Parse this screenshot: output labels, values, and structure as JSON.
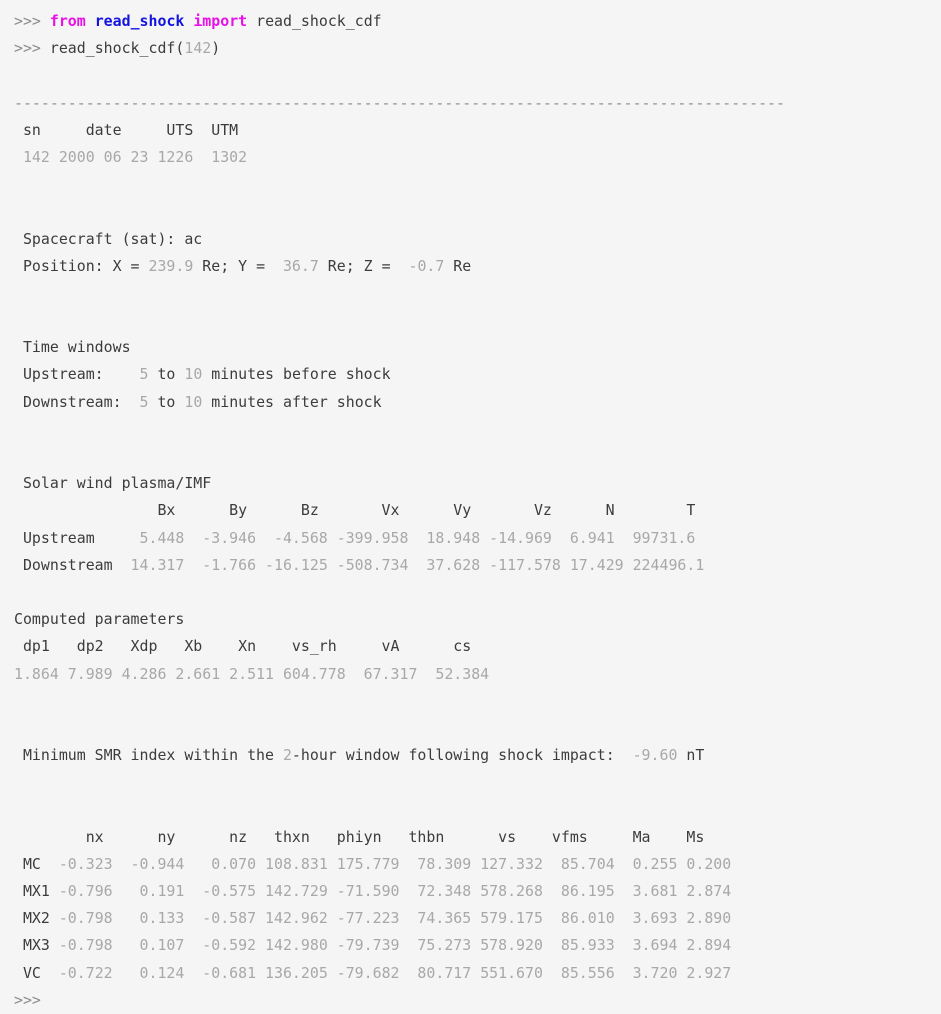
{
  "colors": {
    "background": "#f5f5f5",
    "text": "#3c3c3c",
    "value": "#a8a8a8",
    "prompt": "#8c8c8c",
    "keyword": "#e812e8",
    "module": "#1414e0",
    "separator": "#909090"
  },
  "repl": {
    "prompt": ">>>",
    "import_statement": {
      "from_keyword": "from",
      "module": "read_shock",
      "import_keyword": "import",
      "imported_name": "read_shock_cdf"
    },
    "call_statement": {
      "function": "read_shock_cdf",
      "open_paren": "(",
      "argument": "142",
      "close_paren": ")"
    },
    "trailing_prompt": ">>>"
  },
  "separator_line": "--------------------------------------------------------------------------------------",
  "event_header": {
    "columns": [
      "sn",
      "date",
      "UTS",
      "UTM"
    ],
    "header_row": " sn     date     UTS  UTM",
    "values_row": " 142 2000 06 23 1226  1302",
    "sn": "142",
    "date": "2000 06 23",
    "uts": "1226",
    "utm": "1302"
  },
  "spacecraft": {
    "label": " Spacecraft (sat): ",
    "value": "ac",
    "full_line": " Spacecraft (sat): ac"
  },
  "position": {
    "prefix": " Position: X = ",
    "x": "239.9",
    "x_unit": " Re; Y = ",
    "y": " 36.7",
    "y_unit": " Re; Z = ",
    "z": " -0.7",
    "z_unit": " Re"
  },
  "time_windows": {
    "title": " Time windows",
    "upstream": {
      "label": " Upstream:    ",
      "start": "5",
      "to": " to ",
      "end": "10",
      "suffix": " minutes before shock"
    },
    "downstream": {
      "label": " Downstream:  ",
      "start": "5",
      "to": " to ",
      "end": "10",
      "suffix": " minutes after shock"
    }
  },
  "solar_wind": {
    "title": " Solar wind plasma/IMF",
    "header_row": "                Bx      By      Bz       Vx      Vy       Vz      N        T",
    "columns": [
      "Bx",
      "By",
      "Bz",
      "Vx",
      "Vy",
      "Vz",
      "N",
      "T"
    ],
    "rows": [
      {
        "label": " Upstream",
        "row_text": " Upstream     5.448  -3.946  -4.568 -399.958  18.948 -14.969  6.941  99731.6",
        "values": [
          "5.448",
          "-3.946",
          "-4.568",
          "-399.958",
          "18.948",
          "-14.969",
          "6.941",
          "99731.6"
        ]
      },
      {
        "label": " Downstream",
        "row_text": " Downstream  14.317  -1.766 -16.125 -508.734  37.628 -117.578 17.429 224496.1",
        "values": [
          "14.317",
          "-1.766",
          "-16.125",
          "-508.734",
          "37.628",
          "-117.578",
          "17.429",
          "224496.1"
        ]
      }
    ]
  },
  "computed_parameters": {
    "title": "Computed parameters",
    "header_row": " dp1   dp2   Xdp   Xb    Xn    vs_rh     vA      cs",
    "columns": [
      "dp1",
      "dp2",
      "Xdp",
      "Xb",
      "Xn",
      "vs_rh",
      "vA",
      "cs"
    ],
    "values_row": "1.864 7.989 4.286 2.661 2.511 604.778  67.317  52.384",
    "values": [
      "1.864",
      "7.989",
      "4.286",
      "2.661",
      "2.511",
      "604.778",
      "67.317",
      "52.384"
    ]
  },
  "smr": {
    "prefix": " Minimum SMR index within the ",
    "window": "2",
    "middle": "-hour window following shock impact:  ",
    "value": "-9.60",
    "unit": " nT"
  },
  "shock_normals": {
    "header_row": "        nx      ny      nz   thxn   phiyn   thbn      vs    vfms     Ma    Ms",
    "columns": [
      "nx",
      "ny",
      "nz",
      "thxn",
      "phiyn",
      "thbn",
      "vs",
      "vfms",
      "Ma",
      "Ms"
    ],
    "rows": [
      {
        "method": "MC",
        "row_text": " MC  -0.323  -0.944   0.070 108.831 175.779  78.309 127.332  85.704  0.255 0.200",
        "values": [
          "-0.323",
          "-0.944",
          "0.070",
          "108.831",
          "175.779",
          "78.309",
          "127.332",
          "85.704",
          "0.255",
          "0.200"
        ]
      },
      {
        "method": "MX1",
        "row_text": " MX1 -0.796   0.191  -0.575 142.729 -71.590  72.348 578.268  86.195  3.681 2.874",
        "values": [
          "-0.796",
          "0.191",
          "-0.575",
          "142.729",
          "-71.590",
          "72.348",
          "578.268",
          "86.195",
          "3.681",
          "2.874"
        ]
      },
      {
        "method": "MX2",
        "row_text": " MX2 -0.798   0.133  -0.587 142.962 -77.223  74.365 579.175  86.010  3.693 2.890",
        "values": [
          "-0.798",
          "0.133",
          "-0.587",
          "142.962",
          "-77.223",
          "74.365",
          "579.175",
          "86.010",
          "3.693",
          "2.890"
        ]
      },
      {
        "method": "MX3",
        "row_text": " MX3 -0.798   0.107  -0.592 142.980 -79.739  75.273 578.920  85.933  3.694 2.894",
        "values": [
          "-0.798",
          "0.107",
          "-0.592",
          "142.980",
          "-79.739",
          "75.273",
          "578.920",
          "85.933",
          "3.694",
          "2.894"
        ]
      },
      {
        "method": "VC",
        "row_text": " VC  -0.722   0.124  -0.681 136.205 -79.682  80.717 551.670  85.556  3.720 2.927",
        "values": [
          "-0.722",
          "0.124",
          "-0.681",
          "136.205",
          "-79.682",
          "80.717",
          "551.670",
          "85.556",
          "3.720",
          "2.927"
        ]
      }
    ]
  }
}
